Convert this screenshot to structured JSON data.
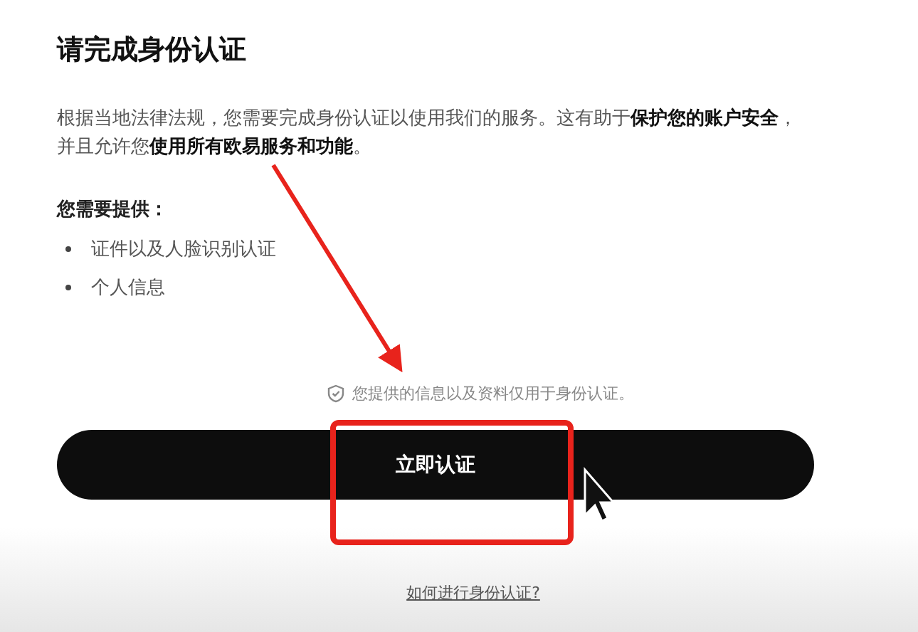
{
  "title": "请完成身份认证",
  "intro": "根据当地法律法规，您需要完成身份认证以使用我们的服务。这有助于**保护您的账户安全**，并且允许您**使用所有欧易服务和功能**。",
  "requirements_heading": "您需要提供：",
  "requirements": [
    "证件以及人脸识别认证",
    "个人信息"
  ],
  "privacy_note": "您提供的信息以及资料仅用于身份认证。",
  "primary_button": "立即认证",
  "help_link": "如何进行身份认证?"
}
